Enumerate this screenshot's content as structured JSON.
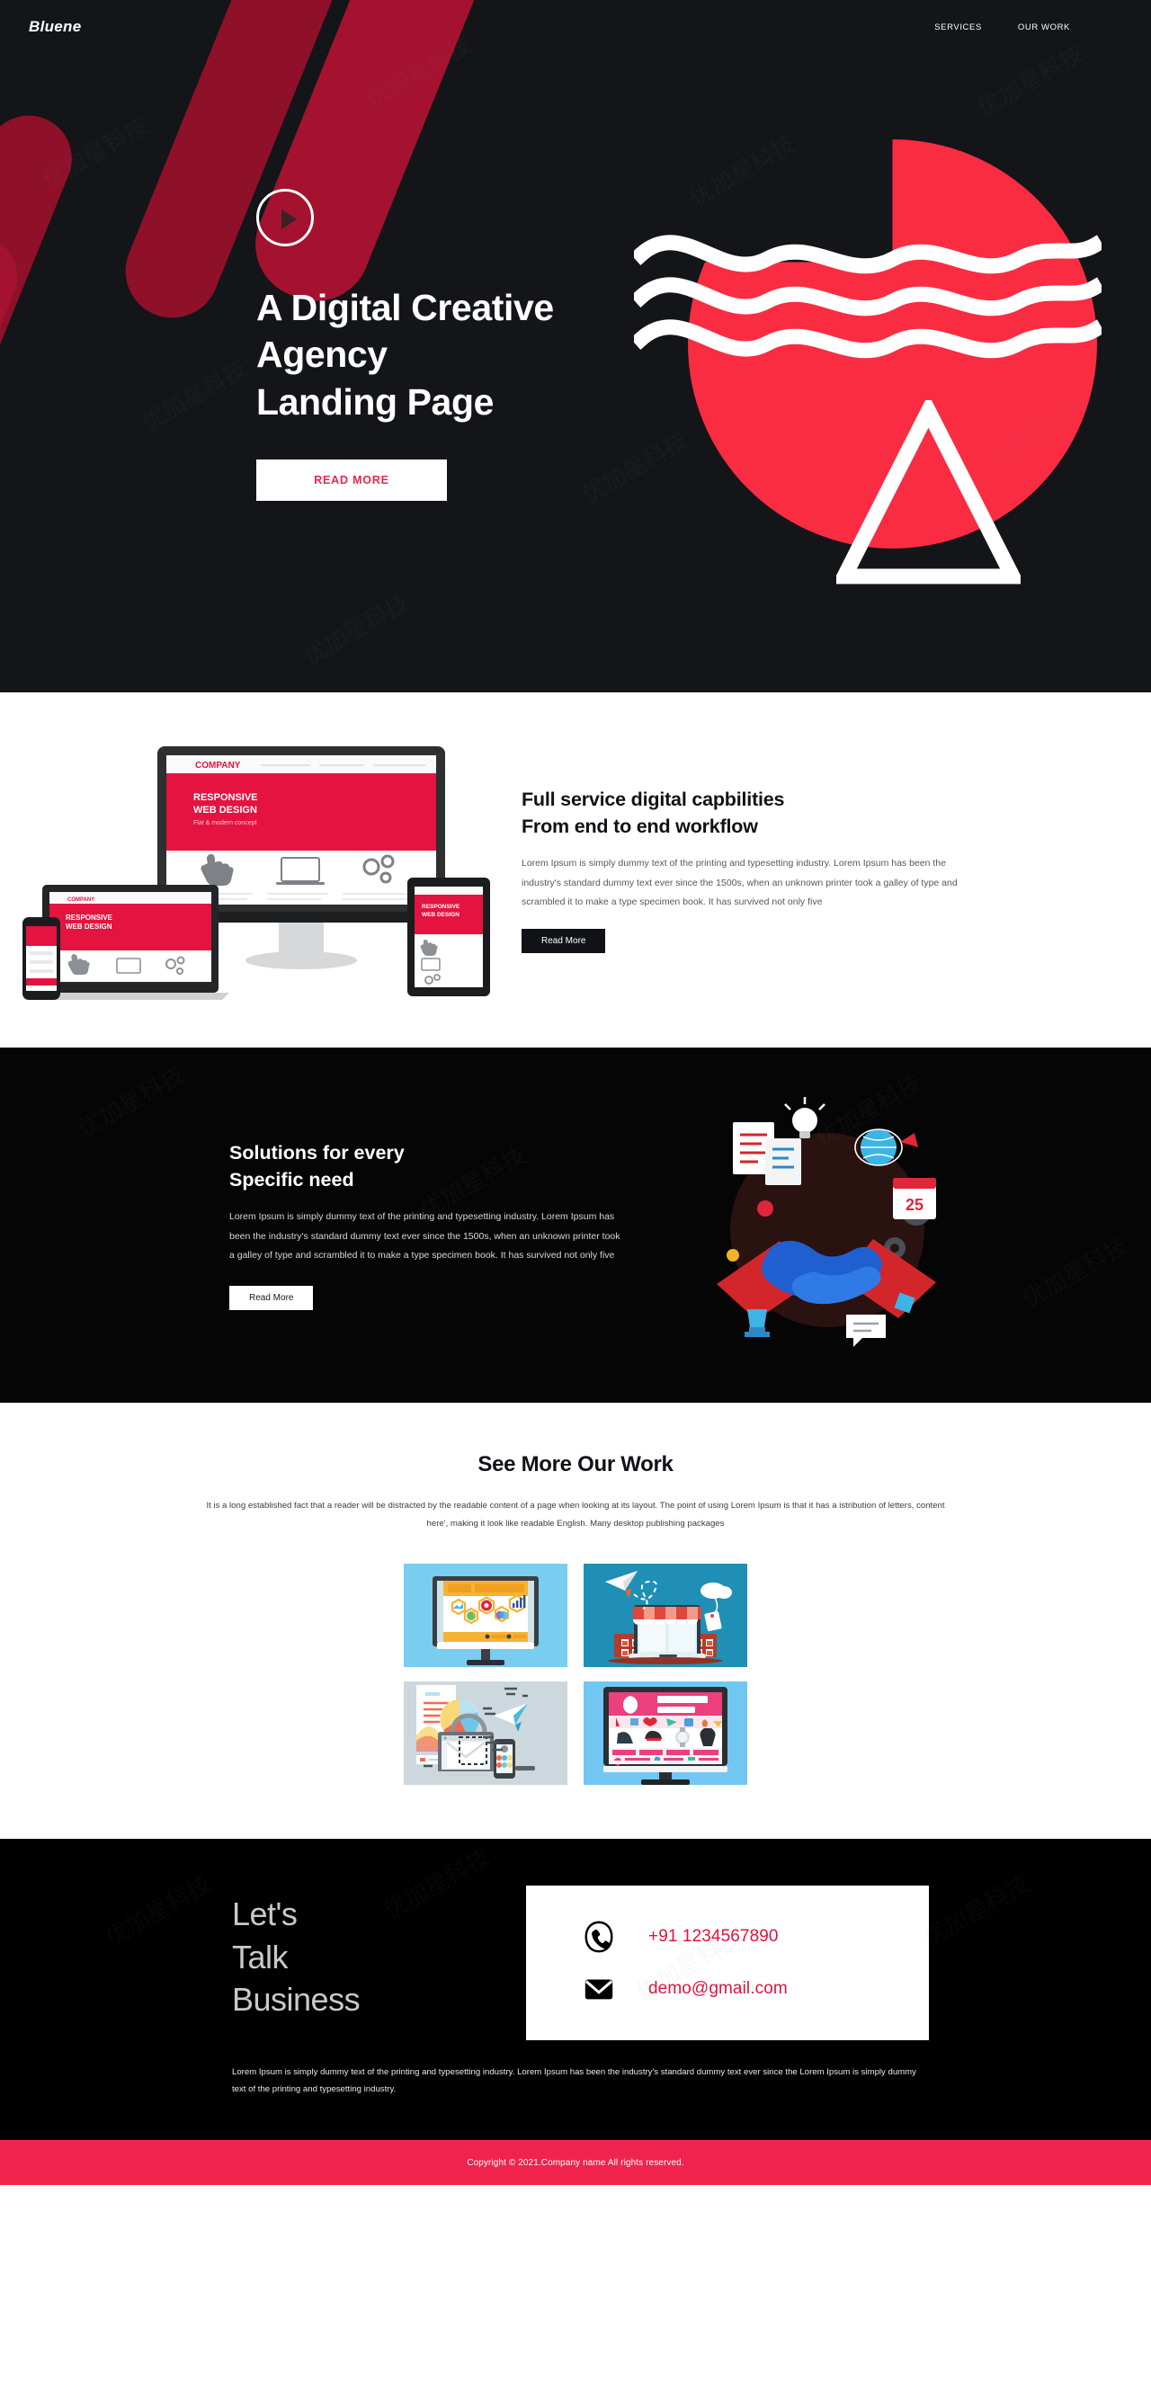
{
  "nav": {
    "brand": "Bluene",
    "links": [
      {
        "label": "SERVICES"
      },
      {
        "label": "OUR WORK"
      }
    ]
  },
  "hero": {
    "play_icon": "play-icon",
    "title_line1": "A Digital Creative",
    "title_line2": "Agency",
    "title_line3": "Landing Page",
    "cta_label": "READ MORE",
    "bg_color": "#131519",
    "accent_color": "#fa2c42",
    "stripe_color": "#a4122f",
    "cta_text_color": "#f0234d"
  },
  "capabilities": {
    "title_line1": "Full service digital capbilities",
    "title_line2": "From end to end workflow",
    "paragraph": "Lorem Ipsum is simply dummy text of the printing and typesetting industry. Lorem Ipsum has been the industry's standard dummy text ever since the 1500s, when an unknown printer took a galley of type and scrambled it to make a type specimen book. It has survived not only five",
    "cta_label": "Read More",
    "mockup_brand": "COMPANY",
    "mockup_headline1": "RESPONSIVE",
    "mockup_headline2": "WEB DESIGN",
    "mockup_sub": "Flat & modern concept"
  },
  "solutions": {
    "title_line1": "Solutions for every",
    "title_line2": "Specific need",
    "paragraph": "Lorem Ipsum is simply dummy text of the printing and typesetting industry. Lorem Ipsum has been the industry's standard dummy text ever since the 1500s, when an unknown printer took a galley of type and scrambled it to make a type specimen book. It has survived not only five",
    "cta_label": "Read More",
    "bg_color": "#050505",
    "calendar_day": "25"
  },
  "work": {
    "title": "See More Our Work",
    "paragraph": "It is a long established fact that a reader will be distracted by the readable content of a page when looking at its layout. The point of using Lorem Ipsum is that it has a istribution of letters, content here', making it look like readable English. Many desktop publishing packages",
    "items": [
      {
        "name": "analytics-dashboard-monitor",
        "bg": "#79cdee"
      },
      {
        "name": "ecommerce-shop-laptop",
        "bg": "#1f8fb5"
      },
      {
        "name": "email-marketing-desk",
        "bg": "#cdd7de"
      },
      {
        "name": "fashion-store-monitor",
        "bg": "#72c7f2"
      }
    ]
  },
  "contact": {
    "heading_line1": "Let's",
    "heading_line2": "Talk",
    "heading_line3": "Business",
    "phone_icon": "phone-icon",
    "phone": "+91 1234567890",
    "email_icon": "envelope-icon",
    "email": "demo@gmail.com",
    "paragraph": "Lorem Ipsum is simply dummy text of the printing and typesetting industry. Lorem Ipsum has been the industry's standard dummy text ever since the Lorem Ipsum is simply dummy text of the printing and typesetting industry.",
    "accent_color": "#e0123c"
  },
  "footer": {
    "copyright": "Copyright © 2021.Company name All rights reserved.",
    "bar_color": "#f0234d"
  },
  "watermark": {
    "text": "优加星科技"
  }
}
